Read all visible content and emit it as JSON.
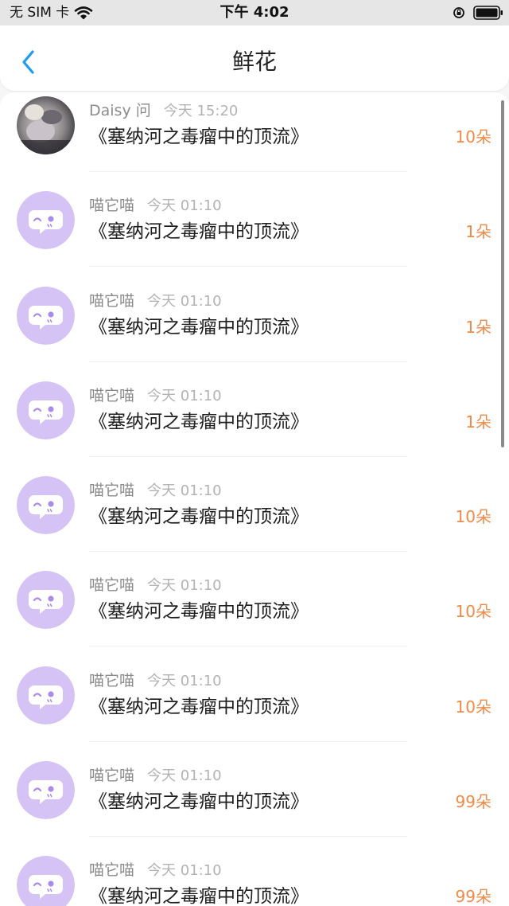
{
  "status_bar": {
    "carrier": "无 SIM 卡",
    "time": "下午 4:02",
    "icons": [
      "wifi-icon",
      "orientation-lock-icon",
      "battery-icon"
    ]
  },
  "nav": {
    "title": "鲜花",
    "back_icon": "chevron-left-icon"
  },
  "colors": {
    "accent": "#1e9bf0",
    "amount": "#ee8b49",
    "avatar_purple": "#d6c3f6",
    "avatar_face": "#a98be9"
  },
  "items": [
    {
      "sender": "Daisy 问",
      "time": "今天 15:20",
      "subject": "《塞纳河之毒瘤中的顶流》",
      "amount": "10朵",
      "avatar": "photo"
    },
    {
      "sender": "喵它喵",
      "time": "今天 01:10",
      "subject": "《塞纳河之毒瘤中的顶流》",
      "amount": "1朵",
      "avatar": "chat-bubble"
    },
    {
      "sender": "喵它喵",
      "time": "今天 01:10",
      "subject": "《塞纳河之毒瘤中的顶流》",
      "amount": "1朵",
      "avatar": "chat-bubble"
    },
    {
      "sender": "喵它喵",
      "time": "今天 01:10",
      "subject": "《塞纳河之毒瘤中的顶流》",
      "amount": "1朵",
      "avatar": "chat-bubble"
    },
    {
      "sender": "喵它喵",
      "time": "今天 01:10",
      "subject": "《塞纳河之毒瘤中的顶流》",
      "amount": "10朵",
      "avatar": "chat-bubble"
    },
    {
      "sender": "喵它喵",
      "time": "今天 01:10",
      "subject": "《塞纳河之毒瘤中的顶流》",
      "amount": "10朵",
      "avatar": "chat-bubble"
    },
    {
      "sender": "喵它喵",
      "time": "今天 01:10",
      "subject": "《塞纳河之毒瘤中的顶流》",
      "amount": "10朵",
      "avatar": "chat-bubble"
    },
    {
      "sender": "喵它喵",
      "time": "今天 01:10",
      "subject": "《塞纳河之毒瘤中的顶流》",
      "amount": "99朵",
      "avatar": "chat-bubble"
    },
    {
      "sender": "喵它喵",
      "time": "今天 01:10",
      "subject": "《塞纳河之毒瘤中的顶流》",
      "amount": "99朵",
      "avatar": "chat-bubble"
    }
  ]
}
